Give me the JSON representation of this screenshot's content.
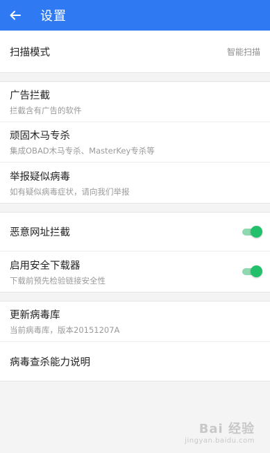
{
  "header": {
    "title": "设置",
    "back_icon": "arrow-left-icon"
  },
  "scan": {
    "title": "扫描模式",
    "value": "智能扫描"
  },
  "group2": [
    {
      "title": "广告拦截",
      "subtitle": "拦截含有广告的软件"
    },
    {
      "title": "顽固木马专杀",
      "subtitle": "集成OBAD木马专杀、MasterKey专杀等"
    },
    {
      "title": "举报疑似病毒",
      "subtitle": "如有疑似病毒症状，请向我们举报"
    }
  ],
  "group3": [
    {
      "title": "恶意网址拦截",
      "subtitle": "",
      "toggle": true
    },
    {
      "title": "启用安全下载器",
      "subtitle": "下载前预先检验链接安全性",
      "toggle": true
    }
  ],
  "group4": [
    {
      "title": "更新病毒库",
      "subtitle": "当前病毒库，版本20151207A"
    },
    {
      "title": "病毒查杀能力说明"
    }
  ],
  "watermark": {
    "brand": "Bai 经验",
    "url": "jingyan.baidu.com"
  },
  "colors": {
    "header": "#2f7af2",
    "toggle_on": "#22c06a"
  }
}
